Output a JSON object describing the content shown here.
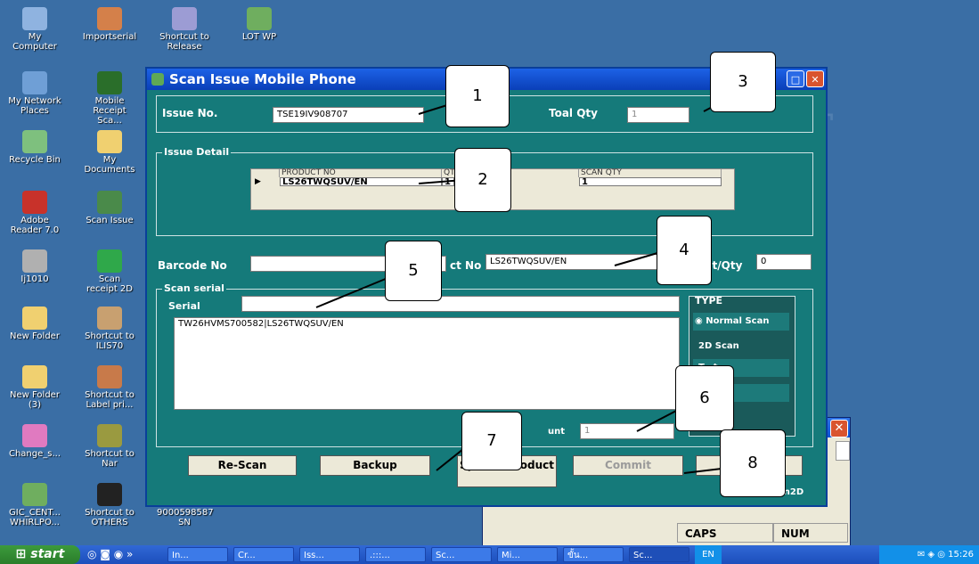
{
  "desktop": {
    "icons": [
      {
        "label": "My Computer"
      },
      {
        "label": "Importserial"
      },
      {
        "label": "Shortcut to Release"
      },
      {
        "label": "LOT WP"
      },
      {
        "label": "My Network Places"
      },
      {
        "label": "Mobile Receipt Sca..."
      },
      {
        "label": "Recycle Bin"
      },
      {
        "label": "My Documents"
      },
      {
        "label": "Adobe Reader 7.0"
      },
      {
        "label": "Scan Issue"
      },
      {
        "label": "Ij1010"
      },
      {
        "label": "Scan receipt 2D"
      },
      {
        "label": "New Folder"
      },
      {
        "label": "Shortcut to ILIS70"
      },
      {
        "label": "New Folder (3)"
      },
      {
        "label": "Shortcut to Label pri..."
      },
      {
        "label": "Change_s..."
      },
      {
        "label": "Shortcut to Nar"
      },
      {
        "label": "GIC_CENT... WHIRLPO..."
      },
      {
        "label": "Shortcut to OTHERS"
      },
      {
        "label": "9000598587 SN"
      }
    ]
  },
  "window": {
    "title": "Scan Issue Mobile Phone",
    "issue_no_label": "Issue No.",
    "issue_no_value": "TSE19IV908707",
    "total_qty_label": "Toal Qty",
    "total_qty_value": "1",
    "issue_detail_label": "Issue Detail",
    "grid": {
      "headers": [
        "PRODUCT NO",
        "QT",
        "SCAN QTY"
      ],
      "rows": [
        {
          "product": "LS26TWQSUV/EN",
          "qty": "1",
          "scan_qty": "1"
        }
      ]
    },
    "barcode_label": "Barcode No",
    "barcode_value": "",
    "product_label": "ct No",
    "product_value": "LS26TWQSUV/EN",
    "unit_qty_label": "nt/Qty",
    "unit_qty_value": "0",
    "scan_serial_label": "Scan serial",
    "serial_label": "Serial",
    "serial_value": "",
    "serial_list": "TW26HVMS700582|LS26TWQSUV/EN",
    "count_label": "unt",
    "count_value": "1",
    "type_label": "TYPE",
    "type_options": [
      "Normal Scan",
      "2D Scan",
      "T...t",
      "...OM"
    ],
    "buttons": {
      "rescan": "Re-Scan",
      "backup": "Backup",
      "special": "Special Product",
      "commit": "Commit",
      "last": "L..."
    },
    "footer_hint": "an2D"
  },
  "background_window": {
    "caps": "CAPS",
    "num": "NUM"
  },
  "callouts": [
    "1",
    "2",
    "3",
    "4",
    "5",
    "6",
    "7",
    "8"
  ],
  "taskbar": {
    "start": "start",
    "tasks": [
      "In...",
      "Cr...",
      "Iss...",
      ".:::...",
      "Sc...",
      "Mi...",
      "ขั้น...",
      "Sc..."
    ],
    "lang": "EN",
    "clock": "15:26"
  }
}
